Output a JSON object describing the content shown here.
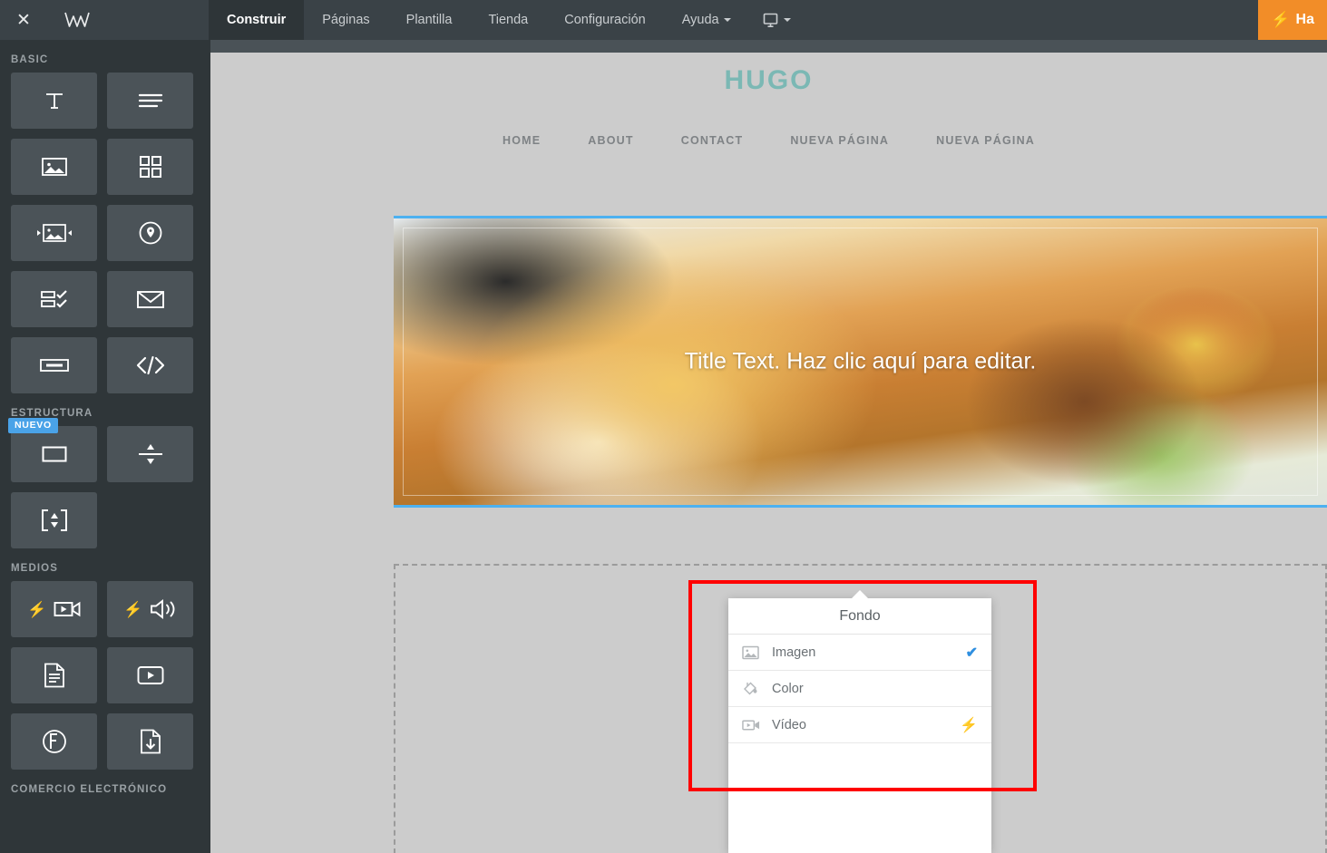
{
  "toolbar": {
    "close_label": "✕",
    "logo_name": "weebly-logo",
    "items": [
      {
        "label": "Construir",
        "active": true,
        "caret": false
      },
      {
        "label": "Páginas",
        "active": false,
        "caret": false
      },
      {
        "label": "Plantilla",
        "active": false,
        "caret": false
      },
      {
        "label": "Tienda",
        "active": false,
        "caret": false
      },
      {
        "label": "Configuración",
        "active": false,
        "caret": false
      },
      {
        "label": "Ayuda",
        "active": false,
        "caret": true
      }
    ],
    "device_icon": "desktop-monitor-icon",
    "upgrade_label": "Ha",
    "upgrade_bolt": "⚡",
    "upgrade_color": "#f28d28"
  },
  "sidebar": {
    "sections": [
      {
        "title": "BASIC",
        "tiles": [
          {
            "name": "title-element",
            "icon": "text-t-icon",
            "bolt": false,
            "badge": ""
          },
          {
            "name": "text-element",
            "icon": "paragraph-lines-icon",
            "bolt": false,
            "badge": ""
          },
          {
            "name": "image-element",
            "icon": "picture-icon",
            "bolt": false,
            "badge": ""
          },
          {
            "name": "gallery-element",
            "icon": "grid-squares-icon",
            "bolt": false,
            "badge": ""
          },
          {
            "name": "slideshow-element",
            "icon": "image-arrows-icon",
            "bolt": false,
            "badge": ""
          },
          {
            "name": "map-element",
            "icon": "map-pin-circle-icon",
            "bolt": false,
            "badge": ""
          },
          {
            "name": "form-element",
            "icon": "form-checklist-icon",
            "bolt": false,
            "badge": ""
          },
          {
            "name": "contact-element",
            "icon": "envelope-icon",
            "bolt": false,
            "badge": ""
          },
          {
            "name": "button-element",
            "icon": "button-icon",
            "bolt": false,
            "badge": ""
          },
          {
            "name": "embed-code-element",
            "icon": "code-brackets-icon",
            "bolt": false,
            "badge": ""
          }
        ]
      },
      {
        "title": "ESTRUCTURA",
        "tiles": [
          {
            "name": "section-element",
            "icon": "rectangle-outline-icon",
            "bolt": false,
            "badge": "NUEVO"
          },
          {
            "name": "divider-element",
            "icon": "spacer-arrows-icon",
            "bolt": false,
            "badge": ""
          },
          {
            "name": "pop-up-element",
            "icon": "expand-frame-icon",
            "bolt": false,
            "badge": ""
          }
        ]
      },
      {
        "title": "MEDIOS",
        "tiles": [
          {
            "name": "video-element",
            "icon": "video-camera-icon",
            "bolt": true,
            "badge": ""
          },
          {
            "name": "audio-element",
            "icon": "speaker-sound-icon",
            "bolt": true,
            "badge": ""
          },
          {
            "name": "document-element",
            "icon": "document-lines-icon",
            "bolt": false,
            "badge": ""
          },
          {
            "name": "youtube-element",
            "icon": "play-box-icon",
            "bolt": false,
            "badge": ""
          },
          {
            "name": "flash-element",
            "icon": "flash-circle-icon",
            "bolt": false,
            "badge": ""
          },
          {
            "name": "file-download-element",
            "icon": "file-download-icon",
            "bolt": false,
            "badge": ""
          }
        ]
      },
      {
        "title": "COMERCIO ELECTRÓNICO",
        "tiles": []
      }
    ]
  },
  "site": {
    "logo": "HUGO",
    "logo_color": "#7bb8b4",
    "nav": [
      {
        "label": "HOME"
      },
      {
        "label": "ABOUT"
      },
      {
        "label": "CONTACT"
      },
      {
        "label": "NUEVA PÁGINA"
      },
      {
        "label": "NUEVA PÁGINA"
      }
    ],
    "hero": {
      "title": "Title Text. Haz clic aquí para editar.",
      "selection_color": "#4db1f0",
      "photo_alt": "burger-and-fries-photo"
    }
  },
  "fondo_menu": {
    "title": "Fondo",
    "options": [
      {
        "label": "Imagen",
        "icon": "picture-icon",
        "checked": true,
        "bolt": false
      },
      {
        "label": "Color",
        "icon": "paint-bucket-icon",
        "checked": false,
        "bolt": false
      },
      {
        "label": "Vídeo",
        "icon": "video-camera-icon",
        "checked": false,
        "bolt": true
      }
    ],
    "check_glyph": "✔",
    "bolt_glyph": "⚡",
    "check_color": "#2f8fe0"
  },
  "annotation": {
    "name": "red-highlight-box",
    "color": "#ff0000"
  }
}
